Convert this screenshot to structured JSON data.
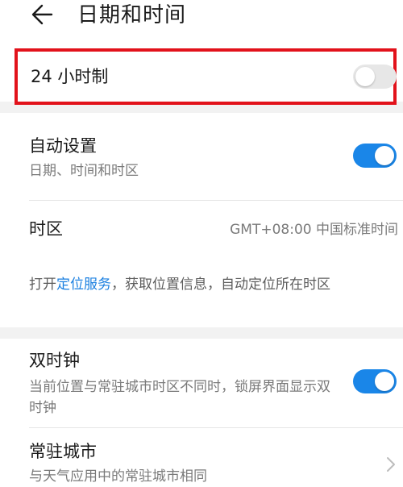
{
  "header": {
    "title": "日期和时间",
    "back_icon": "arrow-left-icon"
  },
  "time_format": {
    "label": "24 小时制",
    "enabled": false
  },
  "auto_set": {
    "label": "自动设置",
    "description": "日期、时间和时区",
    "enabled": true
  },
  "timezone": {
    "label": "时区",
    "value": "GMT+08:00 中国标准时间"
  },
  "location_note": {
    "prefix": "打开",
    "link_text": "定位服务",
    "suffix": "，获取位置信息，自动定位所在时区"
  },
  "dual_clock": {
    "label": "双时钟",
    "description": "当前位置与常驻城市时区不同时，锁屏界面显示双时钟",
    "enabled": true
  },
  "home_city": {
    "label": "常驻城市",
    "description": "与天气应用中的常驻城市相同"
  },
  "colors": {
    "accent": "#1a86e8",
    "link": "#1a7fe0",
    "highlight_border": "#e2121b",
    "toggle_off": "#e7e7e7"
  }
}
